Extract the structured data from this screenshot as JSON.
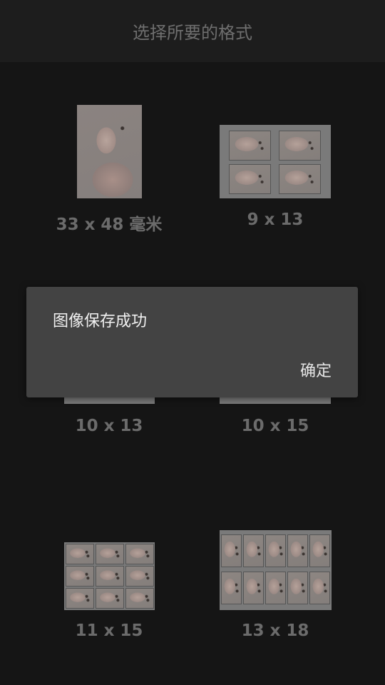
{
  "header": {
    "title": "选择所要的格式"
  },
  "formats": [
    {
      "label": "33 x 48 毫米"
    },
    {
      "label": "9 x 13"
    },
    {
      "label": "10 x 13"
    },
    {
      "label": "10 x 15"
    },
    {
      "label": "11 x 15"
    },
    {
      "label": "13 x 18"
    }
  ],
  "dialog": {
    "message": "图像保存成功",
    "ok_label": "确定"
  }
}
